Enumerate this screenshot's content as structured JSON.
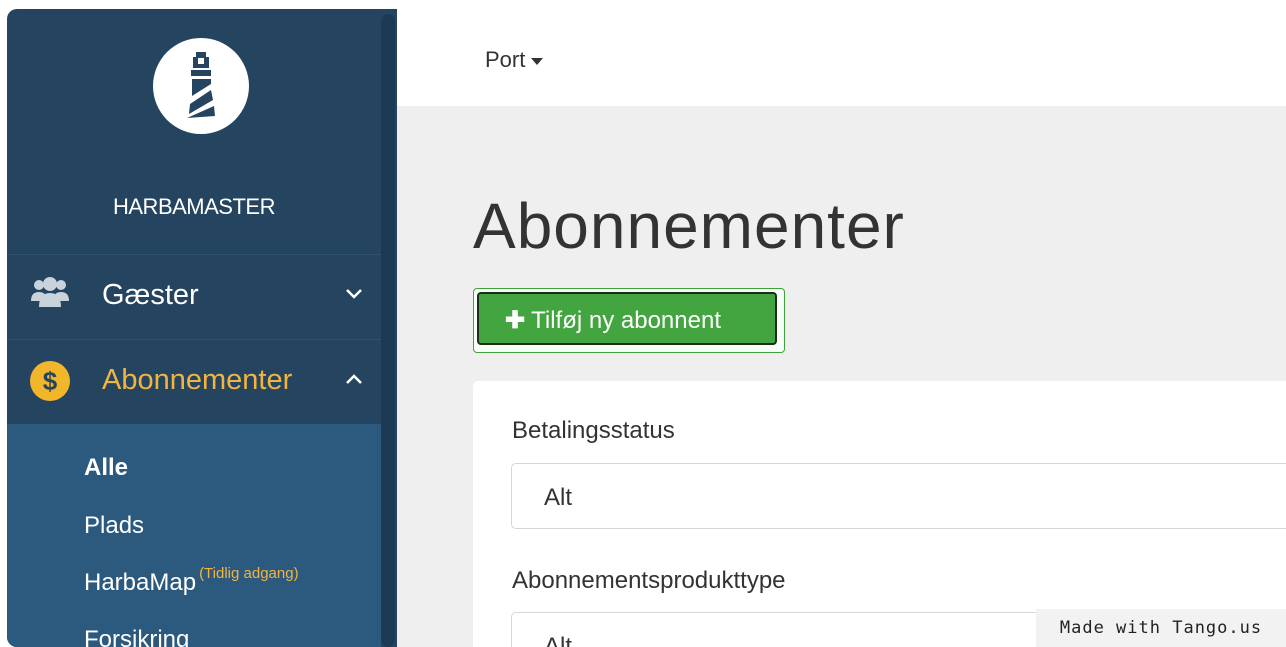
{
  "sidebar": {
    "brand": "HARBAMASTER",
    "nav": [
      {
        "label": "Gæster",
        "icon": "users-icon",
        "chevron": "chevron-down-icon",
        "active": false
      },
      {
        "label": "Abonnementer",
        "icon": "dollar-coin-icon",
        "chevron": "chevron-up-icon",
        "active": true
      }
    ],
    "submenu": [
      {
        "label": "Alle",
        "active": true
      },
      {
        "label": "Plads"
      },
      {
        "label": "HarbaMap",
        "badge": "(Tidlig adgang)"
      },
      {
        "label": "Forsikring"
      }
    ],
    "coin_symbol": "$"
  },
  "topbar": {
    "port_menu": "Port"
  },
  "main": {
    "title": "Abonnementer",
    "add_button": "Tilføj ny abonnent",
    "filters": [
      {
        "label": "Betalingsstatus",
        "value": "Alt"
      },
      {
        "label": "Abonnementsprodukttype",
        "value": "Alt"
      }
    ]
  },
  "watermark": "Made with Tango.us",
  "colors": {
    "sidebar_bg": "#24445f",
    "submenu_bg": "#2c5a7e",
    "accent": "#f2b440",
    "add_button_bg": "#43a540"
  }
}
